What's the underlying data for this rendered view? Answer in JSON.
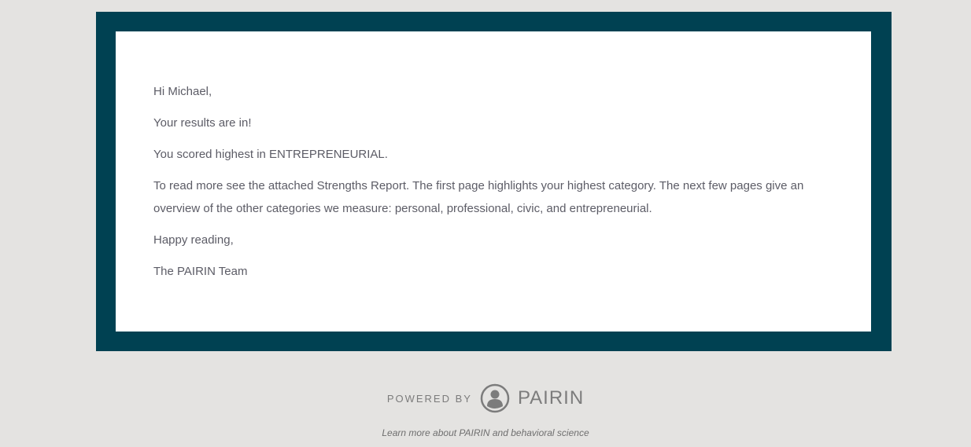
{
  "email": {
    "greeting": "Hi Michael,",
    "line1": "Your results are in!",
    "line2": "You scored highest in ENTREPRENEURIAL.",
    "line3": "To read more see the attached Strengths Report. The first page highlights your highest category. The next few pages give an overview of the other categories we measure: personal, professional, civic, and entrepreneurial.",
    "closing": "Happy reading,",
    "signature": "The PAIRIN Team"
  },
  "footer": {
    "powered_by": "POWERED BY",
    "brand": "PAIRIN",
    "learn_more": "Learn more about PAIRIN and behavioral science"
  },
  "colors": {
    "frame": "#004152",
    "background": "#e4e3e1"
  }
}
